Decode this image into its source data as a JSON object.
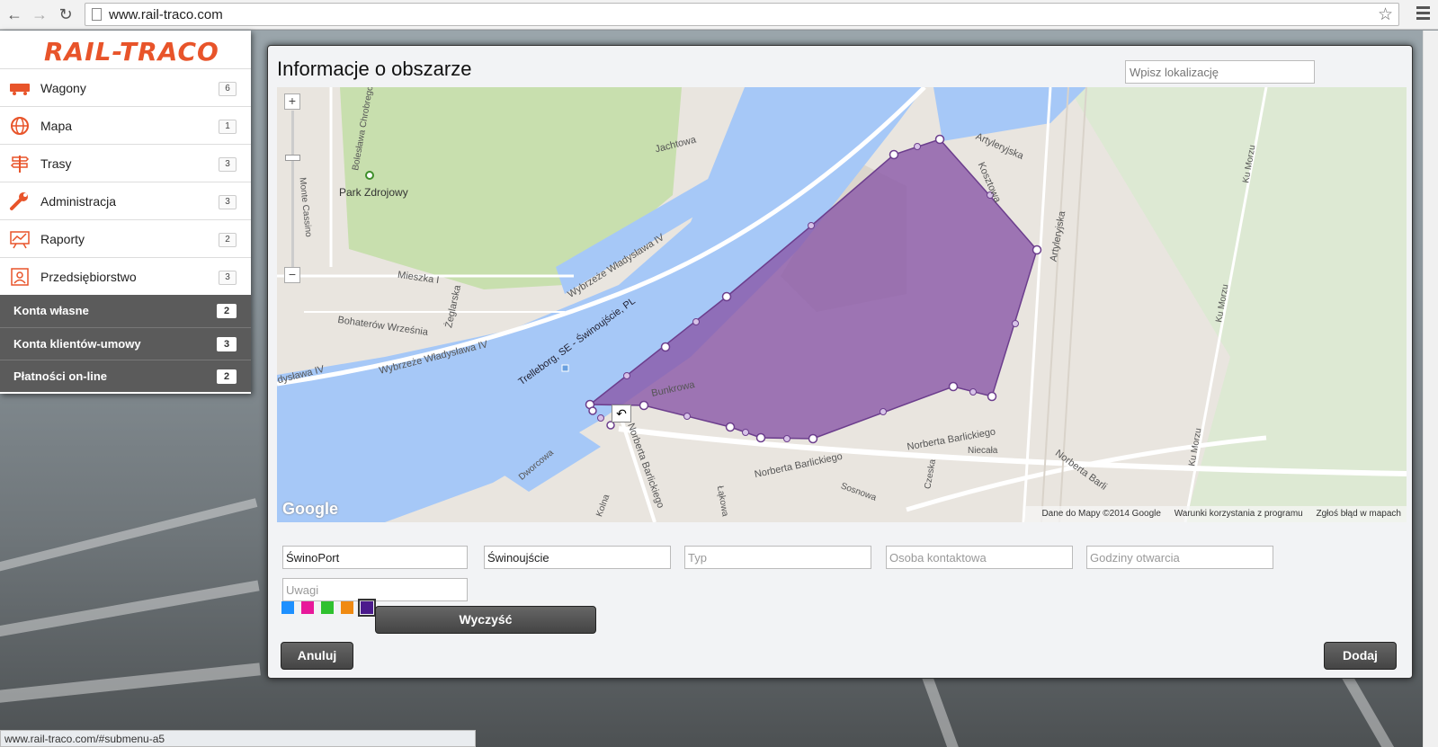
{
  "browser": {
    "url": "www.rail-traco.com",
    "status_url": "www.rail-traco.com/#submenu-a5"
  },
  "sidebar": {
    "logo": "RAIL-TRACO",
    "items": [
      {
        "label": "Wagony",
        "count": "6",
        "icon": "wagon-icon"
      },
      {
        "label": "Mapa",
        "count": "1",
        "icon": "globe-icon"
      },
      {
        "label": "Trasy",
        "count": "3",
        "icon": "signpost-icon"
      },
      {
        "label": "Administracja",
        "count": "3",
        "icon": "wrench-icon"
      },
      {
        "label": "Raporty",
        "count": "2",
        "icon": "chart-icon"
      },
      {
        "label": "Przedsiębiorstwo",
        "count": "3",
        "icon": "company-icon"
      }
    ],
    "subitems": [
      {
        "label": "Konta własne",
        "count": "2"
      },
      {
        "label": "Konta klientów-umowy",
        "count": "3"
      },
      {
        "label": "Płatności on-line",
        "count": "2"
      }
    ]
  },
  "dialog": {
    "title": "Informacje o obszarze",
    "location_placeholder": "Wpisz lokalizację",
    "fields": {
      "name": {
        "value": "ŚwinoPort",
        "placeholder": ""
      },
      "city": {
        "value": "Świnoujście",
        "placeholder": ""
      },
      "type": {
        "value": "",
        "placeholder": "Typ"
      },
      "contact": {
        "value": "",
        "placeholder": "Osoba kontaktowa"
      },
      "hours": {
        "value": "",
        "placeholder": "Godziny otwarcia"
      },
      "notes": {
        "value": "",
        "placeholder": "Uwagi"
      }
    },
    "colors": [
      "#1e90ff",
      "#e8189a",
      "#2fc12f",
      "#f08a12",
      "#4b1a8c"
    ],
    "selected_color": "#4b1a8c",
    "clear_label": "Wyczyść",
    "cancel_label": "Anuluj",
    "add_label": "Dodaj"
  },
  "map": {
    "zoom_in": "+",
    "zoom_out": "−",
    "google": "Google",
    "footer": {
      "data": "Dane do Mapy ©2014 Google",
      "terms": "Warunki korzystania z programu",
      "report": "Zgłoś błąd w mapach"
    },
    "labels": {
      "park": "Park Zdrojowy",
      "jachtowa": "Jachtowa",
      "mieszka": "Mieszka I",
      "zeglarska": "Żeglarska",
      "bohaterow": "Bohaterów Września",
      "wybrzeze1": "Wybrzeże Władysława IV",
      "wybrzeze2": "Wybrzeże Władysława IV",
      "wladyslawa": "dysława IV",
      "ferry": "Trelleborg, SE - Świnoujście, PL",
      "bunkrowa": "Bunkrowa",
      "artyleryjska": "Artyleryjska",
      "kosztowa": "Kosztowa",
      "barlickiego1": "Norberta Barlickiego",
      "barlickiego2": "Norberta Barlickiego",
      "barlickiego3": "Norberta Barlickiego",
      "barli": "Norberta Barli",
      "niecala": "Niecała",
      "czeska": "Czeska",
      "sosnowa": "Sosnowa",
      "dworcowa": "Dworcowa",
      "kumorzu1": "Ku Morzu",
      "kumorzu2": "Ku Morzu",
      "kumorzu3": "Ku Morzu",
      "chrobrego": "Bolesława Chrobrego",
      "cassino": "Monte Cassino",
      "lakowa": "Łąkowa",
      "kolna": "Kolna",
      "artyleryjska2": "Artyleryjska"
    }
  }
}
